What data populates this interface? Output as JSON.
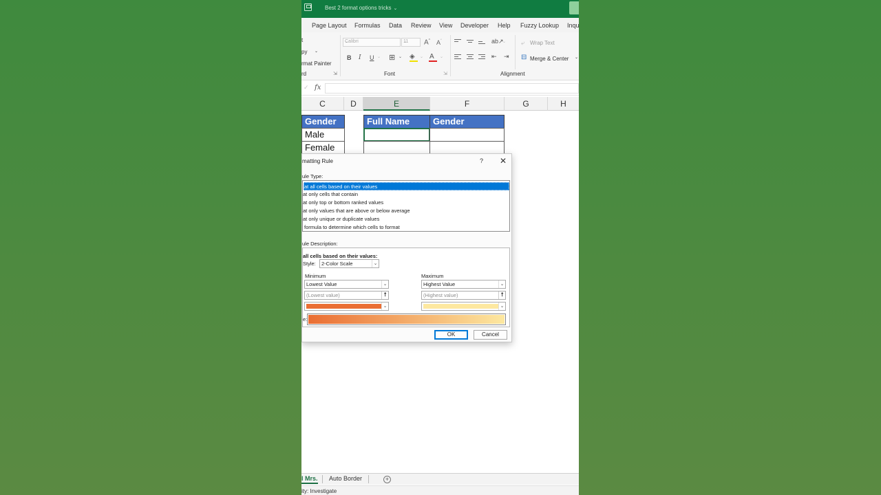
{
  "app": {
    "doc_title": "Best 2 format options tricks",
    "title_chevron": "⌄"
  },
  "menu": {
    "tabs": [
      "Page Layout",
      "Formulas",
      "Data",
      "Review",
      "View",
      "Developer",
      "Help",
      "Fuzzy Lookup",
      "Inqu"
    ]
  },
  "ribbon": {
    "clipboard": {
      "cut": "t",
      "copy": "py",
      "format_painter": "rmat Painter",
      "group_label": "rd"
    },
    "font": {
      "font_name": "Calibri",
      "font_size": "11",
      "bold": "B",
      "italic": "I",
      "underline": "U",
      "group_label": "Font"
    },
    "alignment": {
      "wrap_text": "Wrap Text",
      "merge_center": "Merge & Center",
      "group_label": "Alignment"
    }
  },
  "formula_bar": {
    "fx": "fx",
    "value": ""
  },
  "columns": [
    "C",
    "D",
    "E",
    "F",
    "G",
    "H"
  ],
  "grid": {
    "c_header": "Gender",
    "c_rows": [
      "Male",
      "Female"
    ],
    "e_header": "Full Name",
    "f_header": "Gender"
  },
  "dialog": {
    "title": "matting Rule",
    "help": "?",
    "close": "✕",
    "rule_type_label": "ule Type:",
    "rule_types": [
      "at all cells based on their values",
      "at only cells that contain",
      "at only top or bottom ranked values",
      "at only values that are above or below average",
      "at only unique or duplicate values",
      "formula to determine which cells to format"
    ],
    "rule_desc_label": "ule Description:",
    "desc_heading": "all cells based on their values:",
    "style_label": "Style:",
    "style_value": "2-Color Scale",
    "minimum": {
      "label": "Minimum",
      "type": "Lowest Value",
      "value_placeholder": "(Lowest value)",
      "color": "#ea6e33"
    },
    "maximum": {
      "label": "Maximum",
      "type": "Highest Value",
      "value_placeholder": "(Highest value)",
      "color": "#fde8a0"
    },
    "preview_label": "e:",
    "ok": "OK",
    "cancel": "Cancel"
  },
  "sheets": {
    "active": "l Mrs.",
    "other": "Auto Border",
    "add": "+"
  },
  "status": {
    "text": "ity: Investigate"
  }
}
